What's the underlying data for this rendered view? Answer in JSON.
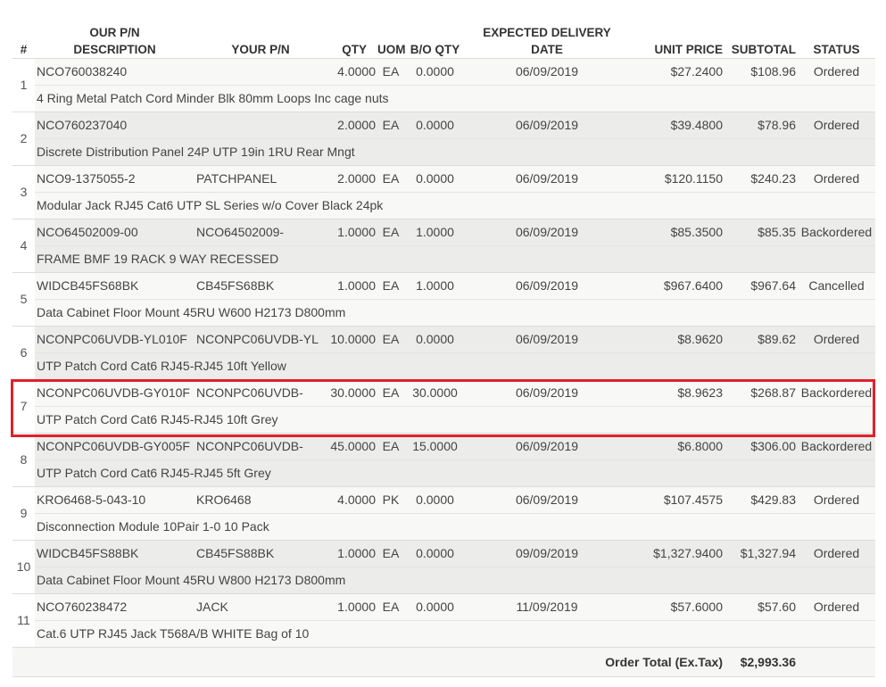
{
  "columns": {
    "num": "#",
    "our_pn": "OUR P/N",
    "description": "DESCRIPTION",
    "your_pn": "YOUR P/N",
    "qty": "QTY",
    "uom": "UOM",
    "bo_qty": "B/O QTY",
    "delivery": "EXPECTED DELIVERY DATE",
    "unit_price": "UNIT PRICE",
    "subtotal": "SUBTOTAL",
    "status": "STATUS"
  },
  "items": [
    {
      "num": "1",
      "our_pn": "NCO760038240",
      "your_pn": "",
      "qty": "4.0000",
      "uom": "EA",
      "bo_qty": "0.0000",
      "delivery": "06/09/2019",
      "unit_price": "$27.2400",
      "subtotal": "$108.96",
      "status": "Ordered",
      "description": "4 Ring Metal Patch Cord Minder Blk 80mm Loops Inc cage nuts"
    },
    {
      "num": "2",
      "our_pn": "NCO760237040",
      "your_pn": "",
      "qty": "2.0000",
      "uom": "EA",
      "bo_qty": "0.0000",
      "delivery": "06/09/2019",
      "unit_price": "$39.4800",
      "subtotal": "$78.96",
      "status": "Ordered",
      "description": "Discrete Distribution Panel 24P UTP 19in 1RU Rear Mngt"
    },
    {
      "num": "3",
      "our_pn": "NCO9-1375055-2",
      "your_pn": "PATCHPANEL",
      "qty": "2.0000",
      "uom": "EA",
      "bo_qty": "0.0000",
      "delivery": "06/09/2019",
      "unit_price": "$120.1150",
      "subtotal": "$240.23",
      "status": "Ordered",
      "description": "Modular Jack RJ45 Cat6 UTP SL Series w/o Cover Black 24pk"
    },
    {
      "num": "4",
      "our_pn": "NCO64502009-00",
      "your_pn": "NCO64502009-",
      "qty": "1.0000",
      "uom": "EA",
      "bo_qty": "1.0000",
      "delivery": "06/09/2019",
      "unit_price": "$85.3500",
      "subtotal": "$85.35",
      "status": "Backordered",
      "description": "FRAME BMF 19 RACK 9 WAY RECESSED"
    },
    {
      "num": "5",
      "our_pn": "WIDCB45FS68BK",
      "your_pn": "CB45FS68BK",
      "qty": "1.0000",
      "uom": "EA",
      "bo_qty": "1.0000",
      "delivery": "06/09/2019",
      "unit_price": "$967.6400",
      "subtotal": "$967.64",
      "status": "Cancelled",
      "description": "Data Cabinet Floor Mount 45RU W600 H2173 D800mm"
    },
    {
      "num": "6",
      "our_pn": "NCONPC06UVDB-YL010F",
      "your_pn": "NCONPC06UVDB-YL",
      "qty": "10.0000",
      "uom": "EA",
      "bo_qty": "0.0000",
      "delivery": "06/09/2019",
      "unit_price": "$8.9620",
      "subtotal": "$89.62",
      "status": "Ordered",
      "description": "UTP Patch Cord Cat6 RJ45-RJ45 10ft Yellow"
    },
    {
      "num": "7",
      "our_pn": "NCONPC06UVDB-GY010F",
      "your_pn": "NCONPC06UVDB-",
      "qty": "30.0000",
      "uom": "EA",
      "bo_qty": "30.0000",
      "delivery": "06/09/2019",
      "unit_price": "$8.9623",
      "subtotal": "$268.87",
      "status": "Backordered",
      "description": "UTP Patch Cord Cat6 RJ45-RJ45 10ft Grey"
    },
    {
      "num": "8",
      "our_pn": "NCONPC06UVDB-GY005F",
      "your_pn": "NCONPC06UVDB-",
      "qty": "45.0000",
      "uom": "EA",
      "bo_qty": "15.0000",
      "delivery": "06/09/2019",
      "unit_price": "$6.8000",
      "subtotal": "$306.00",
      "status": "Backordered",
      "description": "UTP Patch Cord Cat6 RJ45-RJ45 5ft Grey"
    },
    {
      "num": "9",
      "our_pn": "KRO6468-5-043-10",
      "your_pn": "KRO6468",
      "qty": "4.0000",
      "uom": "PK",
      "bo_qty": "0.0000",
      "delivery": "06/09/2019",
      "unit_price": "$107.4575",
      "subtotal": "$429.83",
      "status": "Ordered",
      "description": "Disconnection Module 10Pair 1-0 10 Pack"
    },
    {
      "num": "10",
      "our_pn": "WIDCB45FS88BK",
      "your_pn": "CB45FS88BK",
      "qty": "1.0000",
      "uom": "EA",
      "bo_qty": "0.0000",
      "delivery": "09/09/2019",
      "unit_price": "$1,327.9400",
      "subtotal": "$1,327.94",
      "status": "Ordered",
      "description": "Data Cabinet Floor Mount 45RU W800 H2173 D800mm"
    },
    {
      "num": "11",
      "our_pn": "NCO760238472",
      "your_pn": "JACK",
      "qty": "1.0000",
      "uom": "EA",
      "bo_qty": "0.0000",
      "delivery": "11/09/2019",
      "unit_price": "$57.6000",
      "subtotal": "$57.60",
      "status": "Ordered",
      "description": "Cat.6 UTP RJ45 Jack T568A/B WHITE Bag of 10"
    }
  ],
  "footer": {
    "total_label": "Order Total (Ex.Tax)",
    "total_value": "$2,993.36"
  },
  "highlight": {
    "color": "#e0212b"
  }
}
